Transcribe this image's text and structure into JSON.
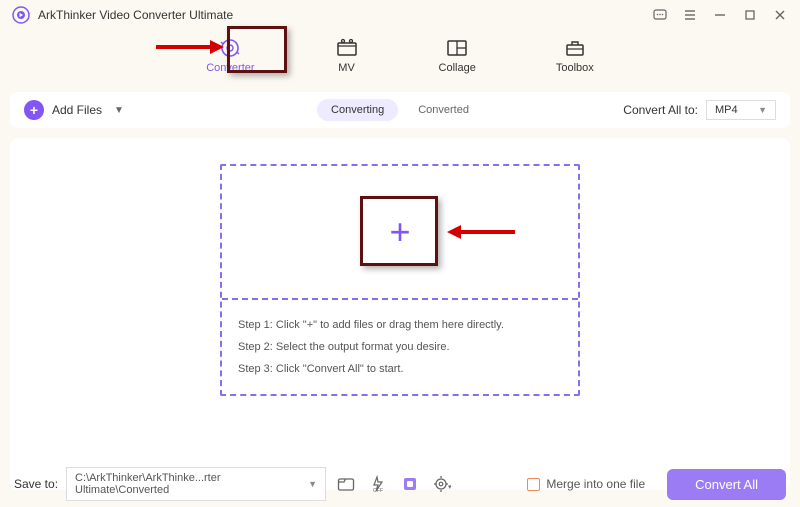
{
  "app": {
    "title": "ArkThinker Video Converter Ultimate"
  },
  "tabs": [
    {
      "label": "Converter",
      "active": true
    },
    {
      "label": "MV",
      "active": false
    },
    {
      "label": "Collage",
      "active": false
    },
    {
      "label": "Toolbox",
      "active": false
    }
  ],
  "toolbar": {
    "add_files": "Add Files",
    "converting": "Converting",
    "converted": "Converted",
    "convert_all_to": "Convert All to:",
    "format": "MP4"
  },
  "steps": {
    "s1": "Step 1: Click \"+\" to add files or drag them here directly.",
    "s2": "Step 2: Select the output format you desire.",
    "s3": "Step 3: Click \"Convert All\" to start."
  },
  "footer": {
    "save_to": "Save to:",
    "path": "C:\\ArkThinker\\ArkThinke...rter Ultimate\\Converted",
    "merge": "Merge into one file",
    "convert_all": "Convert All"
  }
}
